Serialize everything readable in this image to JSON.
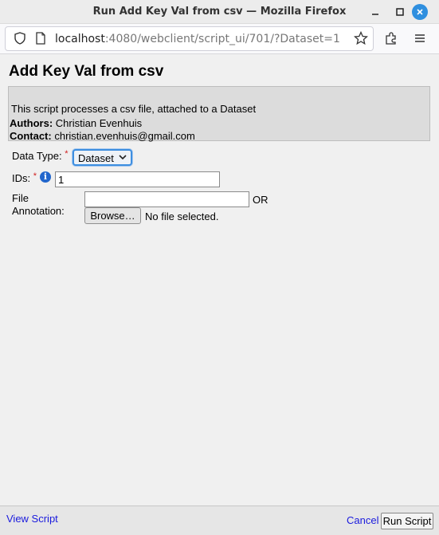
{
  "window": {
    "title": "Run Add Key Val from csv — Mozilla Firefox"
  },
  "browser": {
    "url_host": "localhost",
    "url_rest": ":4080/webclient/script_ui/701/?Dataset=1"
  },
  "page": {
    "title": "Add Key Val from csv",
    "description": "This script processes a csv file, attached to a Dataset",
    "authors_label": "Authors:",
    "authors": "Christian Evenhuis",
    "contact_label": "Contact:",
    "contact": "christian.evenhuis@gmail.com"
  },
  "form": {
    "data_type_label": "Data Type:",
    "required_mark": "*",
    "data_type_value": "Dataset",
    "ids_label": "IDs:",
    "ids_value": "1",
    "file_label_line1": "File",
    "file_label_line2": "Annotation:",
    "file_annotation_value": "",
    "or_text": "OR",
    "browse_label": "Browse…",
    "file_status": "No file selected."
  },
  "footer": {
    "view_script": "View Script",
    "cancel": "Cancel",
    "run_script": "Run Script"
  },
  "colors": {
    "link": "#1a1add",
    "required": "#d02020",
    "focus": "#3d8ee0",
    "close_button": "#2f8fdf"
  }
}
